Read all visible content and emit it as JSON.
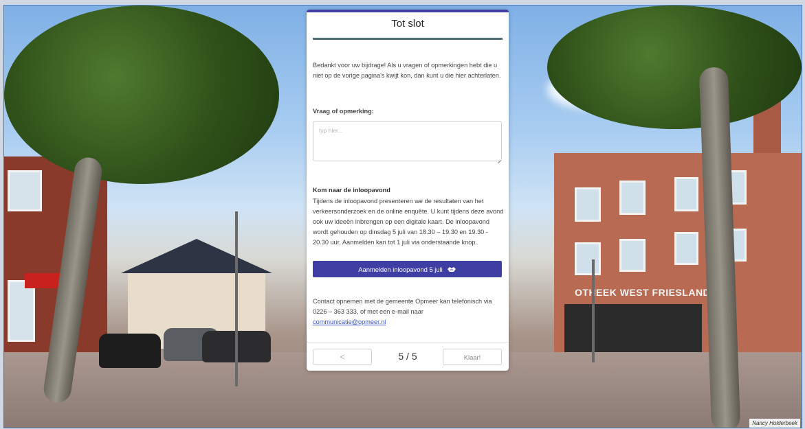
{
  "modal": {
    "title": "Tot slot",
    "intro": "Bedankt voor uw bijdrage! Als u vragen of opmerkingen hebt die u niet op de vorige pagina's kwijt kon, dan kunt u die hier achterlaten.",
    "question_label": "Vraag of opmerking:",
    "question_placeholder": "typ hier...",
    "question_value": "",
    "event_heading": "Kom naar de inloopavond",
    "event_text": "Tijdens de inloopavond presenteren we de resultaten van het verkeersonderzoek en de online enquête. U kunt tijdens deze avond ook uw ideeën inbrengen op een digitale kaart. De inloopavond wordt gehouden op dinsdag 5 juli van 18.30 – 19.30 en 19.30 - 20.30 uur. Aanmelden kan tot 1 juli via onderstaande knop.",
    "signup_button": "Aanmelden inloopavond 5 juli",
    "signup_icon": "handshake-icon",
    "contact_text": "Contact opnemen met de gemeente Opmeer kan telefonisch via 0226 – 363 333, of met een e-mail naar",
    "contact_email": "communicatie@opmeer.nl",
    "prev_button": "<",
    "pager": "5 / 5",
    "done_button": "Klaar!"
  },
  "background": {
    "shop_sign": "OTHEEK WEST FRIESLAND",
    "photo_credit": "Nancy Holderbeek"
  },
  "colors": {
    "accent": "#3f3fa3",
    "title_rule": "#4f6f78",
    "link": "#3a55c8"
  }
}
